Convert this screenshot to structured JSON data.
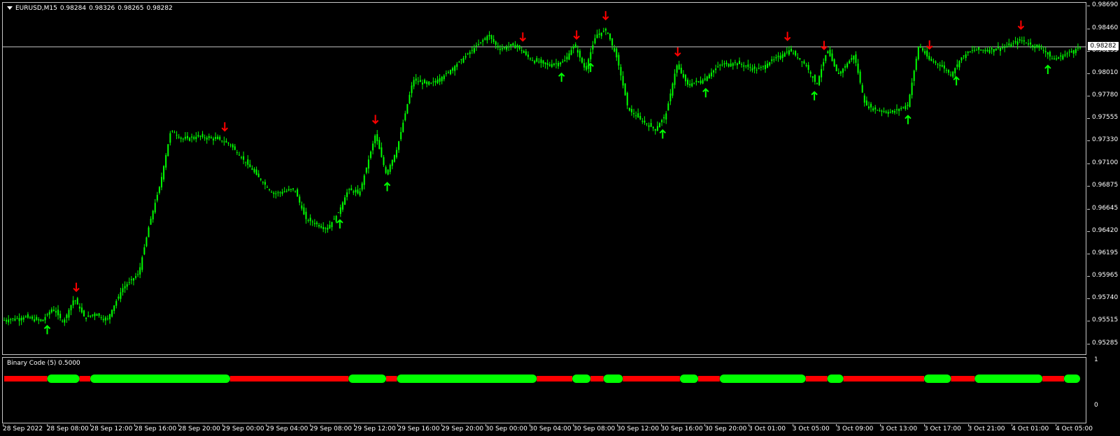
{
  "chart": {
    "symbol_timeframe": "EURUSD,M15",
    "ohlc": [
      "0.98284",
      "0.98326",
      "0.98265",
      "0.98282"
    ],
    "current_price": "0.98282",
    "colors": {
      "background": "#000000",
      "candle": "#00ff00",
      "buy_arrow": "#00ff00",
      "sell_arrow": "#ff0000",
      "grid_line": "#c8c8c8"
    }
  },
  "price_axis": [
    "0.98690",
    "0.98460",
    "0.98235",
    "0.98010",
    "0.97780",
    "0.97555",
    "0.97330",
    "0.97100",
    "0.96875",
    "0.96645",
    "0.96420",
    "0.96195",
    "0.95965",
    "0.95740",
    "0.95515",
    "0.95285"
  ],
  "indicator": {
    "label": "Binary Code (5) 0.5000",
    "scale_top": "1",
    "scale_bottom": "0",
    "segments": [
      {
        "state": "sell",
        "from": 0,
        "to": 0.04
      },
      {
        "state": "buy",
        "from": 0.04,
        "to": 0.07
      },
      {
        "state": "sell",
        "from": 0.07,
        "to": 0.08
      },
      {
        "state": "buy",
        "from": 0.08,
        "to": 0.21
      },
      {
        "state": "sell",
        "from": 0.21,
        "to": 0.32
      },
      {
        "state": "buy",
        "from": 0.32,
        "to": 0.355
      },
      {
        "state": "sell",
        "from": 0.355,
        "to": 0.365
      },
      {
        "state": "buy",
        "from": 0.365,
        "to": 0.495
      },
      {
        "state": "sell",
        "from": 0.495,
        "to": 0.528
      },
      {
        "state": "buy",
        "from": 0.528,
        "to": 0.545
      },
      {
        "state": "sell",
        "from": 0.545,
        "to": 0.557
      },
      {
        "state": "buy",
        "from": 0.557,
        "to": 0.575
      },
      {
        "state": "sell",
        "from": 0.575,
        "to": 0.628
      },
      {
        "state": "buy",
        "from": 0.628,
        "to": 0.645
      },
      {
        "state": "sell",
        "from": 0.645,
        "to": 0.665
      },
      {
        "state": "buy",
        "from": 0.665,
        "to": 0.745
      },
      {
        "state": "sell",
        "from": 0.745,
        "to": 0.765
      },
      {
        "state": "buy",
        "from": 0.765,
        "to": 0.78
      },
      {
        "state": "sell",
        "from": 0.78,
        "to": 0.855
      },
      {
        "state": "buy",
        "from": 0.855,
        "to": 0.88
      },
      {
        "state": "sell",
        "from": 0.88,
        "to": 0.902
      },
      {
        "state": "buy",
        "from": 0.902,
        "to": 0.965
      },
      {
        "state": "sell",
        "from": 0.965,
        "to": 0.985
      },
      {
        "state": "buy",
        "from": 0.985,
        "to": 1.0
      }
    ]
  },
  "time_axis": [
    "28 Sep 2022",
    "28 Sep 08:00",
    "28 Sep 12:00",
    "28 Sep 16:00",
    "28 Sep 20:00",
    "29 Sep 00:00",
    "29 Sep 04:00",
    "29 Sep 08:00",
    "29 Sep 12:00",
    "29 Sep 16:00",
    "29 Sep 20:00",
    "30 Sep 00:00",
    "30 Sep 04:00",
    "30 Sep 08:00",
    "30 Sep 12:00",
    "30 Sep 16:00",
    "30 Sep 20:00",
    "3 Oct 01:00",
    "3 Oct 05:00",
    "3 Oct 09:00",
    "3 Oct 13:00",
    "3 Oct 17:00",
    "3 Oct 21:00",
    "4 Oct 01:00",
    "4 Oct 05:00"
  ],
  "price_path": [
    [
      0,
      0.9553
    ],
    [
      0.02,
      0.9556
    ],
    [
      0.035,
      0.9552
    ],
    [
      0.045,
      0.9565
    ],
    [
      0.055,
      0.9551
    ],
    [
      0.065,
      0.9575
    ],
    [
      0.075,
      0.9555
    ],
    [
      0.085,
      0.956
    ],
    [
      0.095,
      0.9552
    ],
    [
      0.11,
      0.9585
    ],
    [
      0.125,
      0.96
    ],
    [
      0.135,
      0.965
    ],
    [
      0.145,
      0.969
    ],
    [
      0.155,
      0.9745
    ],
    [
      0.165,
      0.9735
    ],
    [
      0.18,
      0.9738
    ],
    [
      0.2,
      0.9735
    ],
    [
      0.21,
      0.973
    ],
    [
      0.23,
      0.9705
    ],
    [
      0.25,
      0.968
    ],
    [
      0.27,
      0.9685
    ],
    [
      0.28,
      0.9655
    ],
    [
      0.3,
      0.9645
    ],
    [
      0.31,
      0.966
    ],
    [
      0.32,
      0.9685
    ],
    [
      0.33,
      0.968
    ],
    [
      0.345,
      0.974
    ],
    [
      0.355,
      0.97
    ],
    [
      0.365,
      0.9725
    ],
    [
      0.38,
      0.9795
    ],
    [
      0.395,
      0.979
    ],
    [
      0.41,
      0.98
    ],
    [
      0.425,
      0.9815
    ],
    [
      0.44,
      0.983
    ],
    [
      0.45,
      0.984
    ],
    [
      0.46,
      0.9826
    ],
    [
      0.475,
      0.983
    ],
    [
      0.49,
      0.9815
    ],
    [
      0.505,
      0.981
    ],
    [
      0.52,
      0.9813
    ],
    [
      0.53,
      0.983
    ],
    [
      0.54,
      0.9805
    ],
    [
      0.55,
      0.984
    ],
    [
      0.56,
      0.9845
    ],
    [
      0.57,
      0.9815
    ],
    [
      0.58,
      0.9765
    ],
    [
      0.595,
      0.9752
    ],
    [
      0.605,
      0.9745
    ],
    [
      0.615,
      0.976
    ],
    [
      0.625,
      0.981
    ],
    [
      0.635,
      0.979
    ],
    [
      0.65,
      0.9795
    ],
    [
      0.665,
      0.981
    ],
    [
      0.68,
      0.9812
    ],
    [
      0.7,
      0.9805
    ],
    [
      0.715,
      0.9815
    ],
    [
      0.73,
      0.9825
    ],
    [
      0.745,
      0.981
    ],
    [
      0.755,
      0.979
    ],
    [
      0.765,
      0.9825
    ],
    [
      0.775,
      0.98
    ],
    [
      0.79,
      0.982
    ],
    [
      0.8,
      0.977
    ],
    [
      0.81,
      0.9765
    ],
    [
      0.825,
      0.9762
    ],
    [
      0.84,
      0.977
    ],
    [
      0.85,
      0.983
    ],
    [
      0.86,
      0.9815
    ],
    [
      0.87,
      0.981
    ],
    [
      0.88,
      0.98
    ],
    [
      0.89,
      0.9818
    ],
    [
      0.9,
      0.9825
    ],
    [
      0.915,
      0.9825
    ],
    [
      0.93,
      0.9828
    ],
    [
      0.945,
      0.9835
    ],
    [
      0.955,
      0.983
    ],
    [
      0.965,
      0.9826
    ],
    [
      0.975,
      0.9815
    ],
    [
      0.985,
      0.982
    ],
    [
      1.0,
      0.9828
    ]
  ],
  "signals": [
    {
      "t": 0.04,
      "dir": "buy"
    },
    {
      "t": 0.067,
      "dir": "sell"
    },
    {
      "t": 0.205,
      "dir": "sell"
    },
    {
      "t": 0.312,
      "dir": "buy"
    },
    {
      "t": 0.345,
      "dir": "sell"
    },
    {
      "t": 0.356,
      "dir": "buy"
    },
    {
      "t": 0.482,
      "dir": "sell"
    },
    {
      "t": 0.518,
      "dir": "buy"
    },
    {
      "t": 0.532,
      "dir": "sell"
    },
    {
      "t": 0.545,
      "dir": "buy"
    },
    {
      "t": 0.559,
      "dir": "sell"
    },
    {
      "t": 0.612,
      "dir": "buy"
    },
    {
      "t": 0.626,
      "dir": "sell"
    },
    {
      "t": 0.652,
      "dir": "buy"
    },
    {
      "t": 0.728,
      "dir": "sell"
    },
    {
      "t": 0.753,
      "dir": "buy"
    },
    {
      "t": 0.762,
      "dir": "sell"
    },
    {
      "t": 0.84,
      "dir": "buy"
    },
    {
      "t": 0.86,
      "dir": "sell"
    },
    {
      "t": 0.885,
      "dir": "buy"
    },
    {
      "t": 0.945,
      "dir": "sell"
    },
    {
      "t": 0.97,
      "dir": "buy"
    }
  ]
}
